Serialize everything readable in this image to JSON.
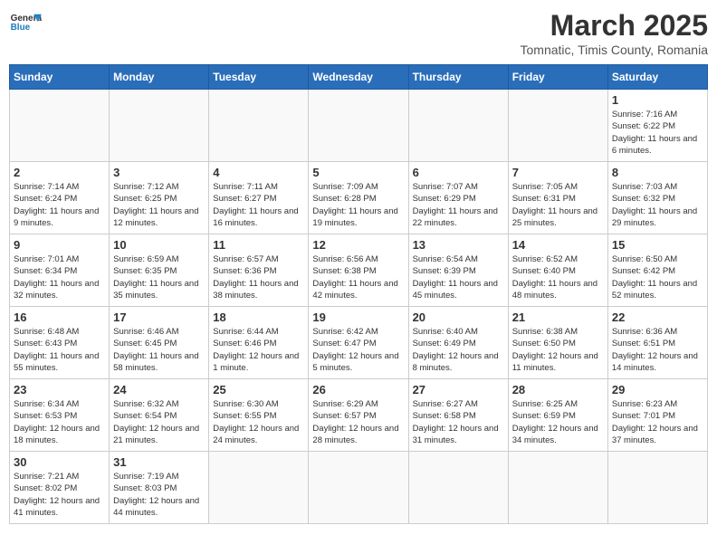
{
  "header": {
    "logo_general": "General",
    "logo_blue": "Blue",
    "month_year": "March 2025",
    "subtitle": "Tomnatic, Timis County, Romania"
  },
  "days_of_week": [
    "Sunday",
    "Monday",
    "Tuesday",
    "Wednesday",
    "Thursday",
    "Friday",
    "Saturday"
  ],
  "weeks": [
    [
      {
        "day": "",
        "info": ""
      },
      {
        "day": "",
        "info": ""
      },
      {
        "day": "",
        "info": ""
      },
      {
        "day": "",
        "info": ""
      },
      {
        "day": "",
        "info": ""
      },
      {
        "day": "",
        "info": ""
      },
      {
        "day": "1",
        "info": "Sunrise: 7:16 AM\nSunset: 6:22 PM\nDaylight: 11 hours and 6 minutes."
      }
    ],
    [
      {
        "day": "2",
        "info": "Sunrise: 7:14 AM\nSunset: 6:24 PM\nDaylight: 11 hours and 9 minutes."
      },
      {
        "day": "3",
        "info": "Sunrise: 7:12 AM\nSunset: 6:25 PM\nDaylight: 11 hours and 12 minutes."
      },
      {
        "day": "4",
        "info": "Sunrise: 7:11 AM\nSunset: 6:27 PM\nDaylight: 11 hours and 16 minutes."
      },
      {
        "day": "5",
        "info": "Sunrise: 7:09 AM\nSunset: 6:28 PM\nDaylight: 11 hours and 19 minutes."
      },
      {
        "day": "6",
        "info": "Sunrise: 7:07 AM\nSunset: 6:29 PM\nDaylight: 11 hours and 22 minutes."
      },
      {
        "day": "7",
        "info": "Sunrise: 7:05 AM\nSunset: 6:31 PM\nDaylight: 11 hours and 25 minutes."
      },
      {
        "day": "8",
        "info": "Sunrise: 7:03 AM\nSunset: 6:32 PM\nDaylight: 11 hours and 29 minutes."
      }
    ],
    [
      {
        "day": "9",
        "info": "Sunrise: 7:01 AM\nSunset: 6:34 PM\nDaylight: 11 hours and 32 minutes."
      },
      {
        "day": "10",
        "info": "Sunrise: 6:59 AM\nSunset: 6:35 PM\nDaylight: 11 hours and 35 minutes."
      },
      {
        "day": "11",
        "info": "Sunrise: 6:57 AM\nSunset: 6:36 PM\nDaylight: 11 hours and 38 minutes."
      },
      {
        "day": "12",
        "info": "Sunrise: 6:56 AM\nSunset: 6:38 PM\nDaylight: 11 hours and 42 minutes."
      },
      {
        "day": "13",
        "info": "Sunrise: 6:54 AM\nSunset: 6:39 PM\nDaylight: 11 hours and 45 minutes."
      },
      {
        "day": "14",
        "info": "Sunrise: 6:52 AM\nSunset: 6:40 PM\nDaylight: 11 hours and 48 minutes."
      },
      {
        "day": "15",
        "info": "Sunrise: 6:50 AM\nSunset: 6:42 PM\nDaylight: 11 hours and 52 minutes."
      }
    ],
    [
      {
        "day": "16",
        "info": "Sunrise: 6:48 AM\nSunset: 6:43 PM\nDaylight: 11 hours and 55 minutes."
      },
      {
        "day": "17",
        "info": "Sunrise: 6:46 AM\nSunset: 6:45 PM\nDaylight: 11 hours and 58 minutes."
      },
      {
        "day": "18",
        "info": "Sunrise: 6:44 AM\nSunset: 6:46 PM\nDaylight: 12 hours and 1 minute."
      },
      {
        "day": "19",
        "info": "Sunrise: 6:42 AM\nSunset: 6:47 PM\nDaylight: 12 hours and 5 minutes."
      },
      {
        "day": "20",
        "info": "Sunrise: 6:40 AM\nSunset: 6:49 PM\nDaylight: 12 hours and 8 minutes."
      },
      {
        "day": "21",
        "info": "Sunrise: 6:38 AM\nSunset: 6:50 PM\nDaylight: 12 hours and 11 minutes."
      },
      {
        "day": "22",
        "info": "Sunrise: 6:36 AM\nSunset: 6:51 PM\nDaylight: 12 hours and 14 minutes."
      }
    ],
    [
      {
        "day": "23",
        "info": "Sunrise: 6:34 AM\nSunset: 6:53 PM\nDaylight: 12 hours and 18 minutes."
      },
      {
        "day": "24",
        "info": "Sunrise: 6:32 AM\nSunset: 6:54 PM\nDaylight: 12 hours and 21 minutes."
      },
      {
        "day": "25",
        "info": "Sunrise: 6:30 AM\nSunset: 6:55 PM\nDaylight: 12 hours and 24 minutes."
      },
      {
        "day": "26",
        "info": "Sunrise: 6:29 AM\nSunset: 6:57 PM\nDaylight: 12 hours and 28 minutes."
      },
      {
        "day": "27",
        "info": "Sunrise: 6:27 AM\nSunset: 6:58 PM\nDaylight: 12 hours and 31 minutes."
      },
      {
        "day": "28",
        "info": "Sunrise: 6:25 AM\nSunset: 6:59 PM\nDaylight: 12 hours and 34 minutes."
      },
      {
        "day": "29",
        "info": "Sunrise: 6:23 AM\nSunset: 7:01 PM\nDaylight: 12 hours and 37 minutes."
      }
    ],
    [
      {
        "day": "30",
        "info": "Sunrise: 7:21 AM\nSunset: 8:02 PM\nDaylight: 12 hours and 41 minutes."
      },
      {
        "day": "31",
        "info": "Sunrise: 7:19 AM\nSunset: 8:03 PM\nDaylight: 12 hours and 44 minutes."
      },
      {
        "day": "",
        "info": ""
      },
      {
        "day": "",
        "info": ""
      },
      {
        "day": "",
        "info": ""
      },
      {
        "day": "",
        "info": ""
      },
      {
        "day": "",
        "info": ""
      }
    ]
  ]
}
